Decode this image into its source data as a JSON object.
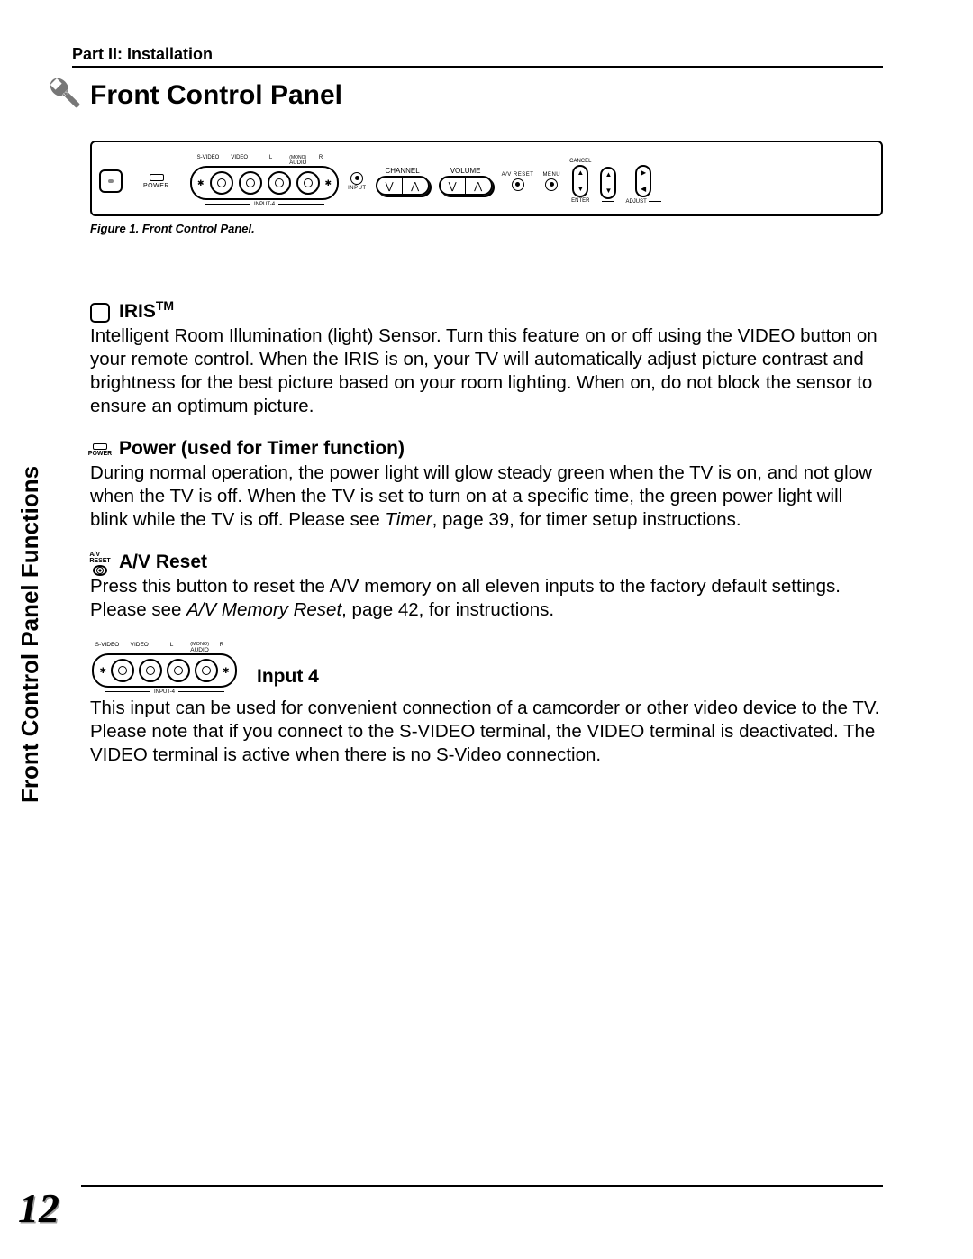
{
  "header": {
    "part": "Part II: Installation"
  },
  "title": "Front Control Panel",
  "figure": {
    "caption_label": "Figure 1.",
    "caption_text": "Front Control Panel.",
    "labels": {
      "power": "POWER",
      "svideo": "S-VIDEO",
      "video": "VIDEO",
      "audio_l": "L",
      "audio": "AUDIO",
      "audio_r": "R",
      "mono": "(MONO)",
      "input4": "INPUT-4",
      "input": "INPUT",
      "channel": "CHANNEL",
      "volume": "VOLUME",
      "avreset": "A/V RESET",
      "menu": "MENU",
      "cancel": "CANCEL",
      "enter": "ENTER",
      "adjust": "ADJUST"
    }
  },
  "side_label": "Front Control Panel Functions",
  "sections": {
    "iris": {
      "heading": "IRIS",
      "tm": "TM",
      "body": "Intelligent Room Illumination (light) Sensor.  Turn this feature on or off using the VIDEO button on your remote control.  When the IRIS is on, your TV will automatically adjust picture contrast and brightness for the best picture based on your room lighting.  When on, do not block the sensor to ensure an optimum picture."
    },
    "power": {
      "icon_text": "POWER",
      "heading": "Power (used for Timer function)",
      "body_1": "During normal operation, the power light will glow steady green when the TV is on, and not glow when the TV is off.  When the TV is set to turn on at a specific time, the green power light will blink while the TV is off.  Please see ",
      "body_em": "Timer",
      "body_2": ", page 39, for timer setup instructions."
    },
    "avreset": {
      "icon_text": "A/V RESET",
      "heading": "A/V Reset",
      "body_1": "Press this button to reset the A/V memory on all eleven inputs to the factory default settings.  Please see ",
      "body_em": "A/V Memory Reset",
      "body_2": ", page 42, for instructions."
    },
    "input4": {
      "heading": "Input 4",
      "body": "This input can be used for convenient connection of a camcorder or other video device to the TV.  Please note that if you connect to the S-VIDEO terminal, the VIDEO terminal is deactivated.  The VIDEO terminal is active when there is no S-Video connection.",
      "fig": {
        "svideo": "S-VIDEO",
        "video": "VIDEO",
        "audio_l": "L",
        "audio": "AUDIO",
        "audio_r": "R",
        "mono": "(MONO)",
        "input4": "INPUT-4"
      }
    }
  },
  "page_number": "12"
}
